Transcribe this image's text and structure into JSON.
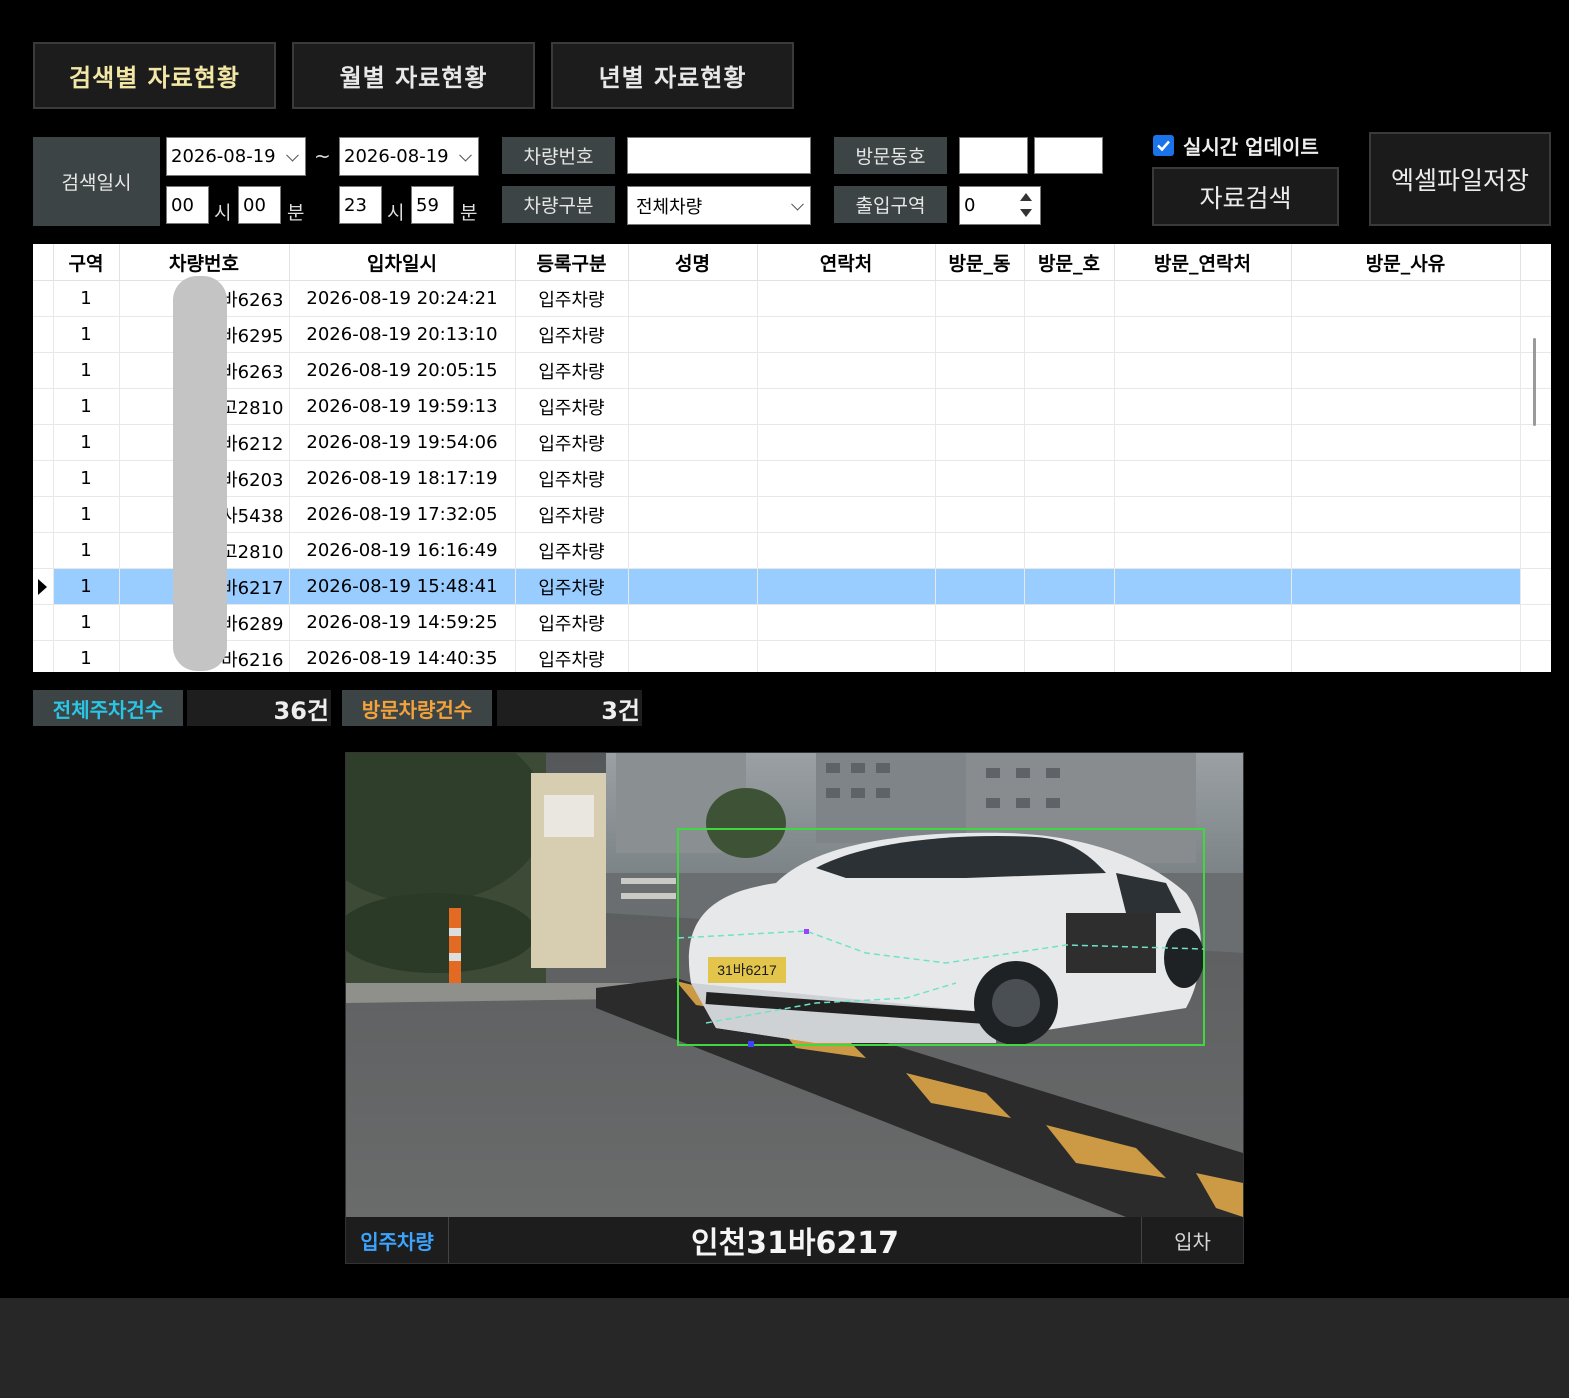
{
  "tabs": [
    "검색별 자료현황",
    "월별 자료현황",
    "년별 자료현황"
  ],
  "search": {
    "date_label": "검색일시",
    "from_date": "2026-08-19",
    "to_date": "2026-08-19",
    "tilde": "~",
    "from_hour": "00",
    "from_min": "00",
    "to_hour": "23",
    "to_min": "59",
    "hour_unit": "시",
    "min_unit": "분",
    "plate_label": "차량번호",
    "plate_value": "",
    "type_label": "차량구분",
    "type_value": "전체차량",
    "visit_label": "방문동호",
    "visit_dong": "",
    "visit_ho": "",
    "zone_label": "출입구역",
    "zone_value": "0",
    "realtime_label": "실시간 업데이트",
    "realtime_checked": true,
    "search_button": "자료검색",
    "excel_button": "엑셀파일저장"
  },
  "grid": {
    "columns": [
      "구역",
      "차량번호",
      "입차일시",
      "등록구분",
      "성명",
      "연락처",
      "방문_동",
      "방문_호",
      "방문_연락처",
      "방문_사유"
    ],
    "rows": [
      {
        "zone": "1",
        "plate": "인      바6263",
        "time": "2026-08-19 20:24:21",
        "type": "입주차량",
        "selected": false
      },
      {
        "zone": "1",
        "plate": "인      바6295",
        "time": "2026-08-19 20:13:10",
        "type": "입주차량",
        "selected": false
      },
      {
        "zone": "1",
        "plate": "인      바6263",
        "time": "2026-08-19 20:05:15",
        "type": "입주차량",
        "selected": false
      },
      {
        "zone": "1",
        "plate": "고2810",
        "time": "2026-08-19 19:59:13",
        "type": "입주차량",
        "selected": false
      },
      {
        "zone": "1",
        "plate": "인      바6212",
        "time": "2026-08-19 19:54:06",
        "type": "입주차량",
        "selected": false
      },
      {
        "zone": "1",
        "plate": "인      바6203",
        "time": "2026-08-19 18:17:19",
        "type": "입주차량",
        "selected": false
      },
      {
        "zone": "1",
        "plate": "사5438",
        "time": "2026-08-19 17:32:05",
        "type": "입주차량",
        "selected": false
      },
      {
        "zone": "1",
        "plate": "고2810",
        "time": "2026-08-19 16:16:49",
        "type": "입주차량",
        "selected": false
      },
      {
        "zone": "1",
        "plate": "인      바6217",
        "time": "2026-08-19 15:48:41",
        "type": "입주차량",
        "selected": true
      },
      {
        "zone": "1",
        "plate": "인      바6289",
        "time": "2026-08-19 14:59:25",
        "type": "입주차량",
        "selected": false
      },
      {
        "zone": "1",
        "plate": "인      바6216",
        "time": "2026-08-19 14:40:35",
        "type": "입주차량",
        "selected": false
      }
    ]
  },
  "summary": {
    "total_label": "전체주차건수",
    "total_value": "36건",
    "visitor_label": "방문차량건수",
    "visitor_value": "3건",
    "total_color": "#29c6e6",
    "visitor_color": "#f4a23a"
  },
  "capture": {
    "type": "입주차량",
    "plate": "인천31바6217",
    "direction": "입차",
    "overlay_plate": "31바6217"
  },
  "colors": {
    "selected_row": "#99ccff",
    "label_bg": "#3d4446",
    "detect_box": "#3fd83f"
  }
}
